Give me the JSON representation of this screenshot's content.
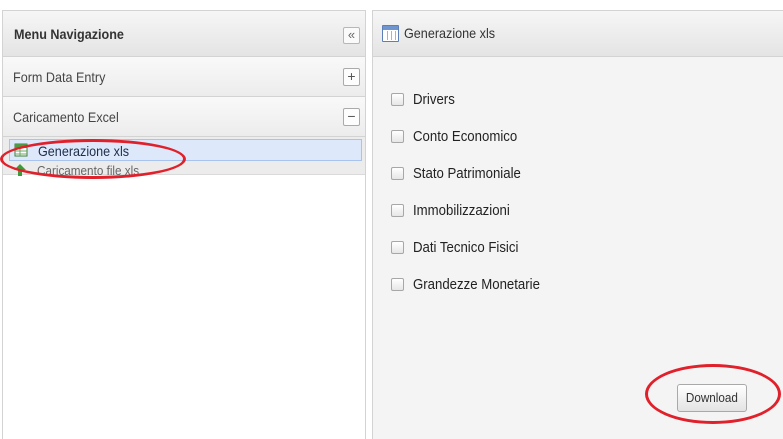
{
  "nav": {
    "title": "Menu Navigazione",
    "collapse_symbol": "«",
    "sections": [
      {
        "label": "Form Data Entry",
        "toggle": "+"
      },
      {
        "label": "Caricamento Excel",
        "toggle": "−"
      }
    ],
    "items": [
      {
        "label": "Generazione xls",
        "icon": "excel-file-icon",
        "selected": true
      },
      {
        "label": "Caricamento file xls",
        "icon": "upload-arrow-icon",
        "selected": false
      }
    ]
  },
  "content": {
    "title": "Generazione xls",
    "icon": "window-icon",
    "options": [
      {
        "label": "Drivers",
        "checked": false
      },
      {
        "label": "Conto Economico",
        "checked": false
      },
      {
        "label": "Stato Patrimoniale",
        "checked": false
      },
      {
        "label": "Immobilizzazioni",
        "checked": false
      },
      {
        "label": "Dati Tecnico Fisici",
        "checked": false
      },
      {
        "label": "Grandezze Monetarie",
        "checked": false
      }
    ],
    "download_label": "Download"
  },
  "colors": {
    "annotation": "#e0202a",
    "selected_bg": "#dde9fb",
    "panel_bg": "#f4f4f4"
  }
}
